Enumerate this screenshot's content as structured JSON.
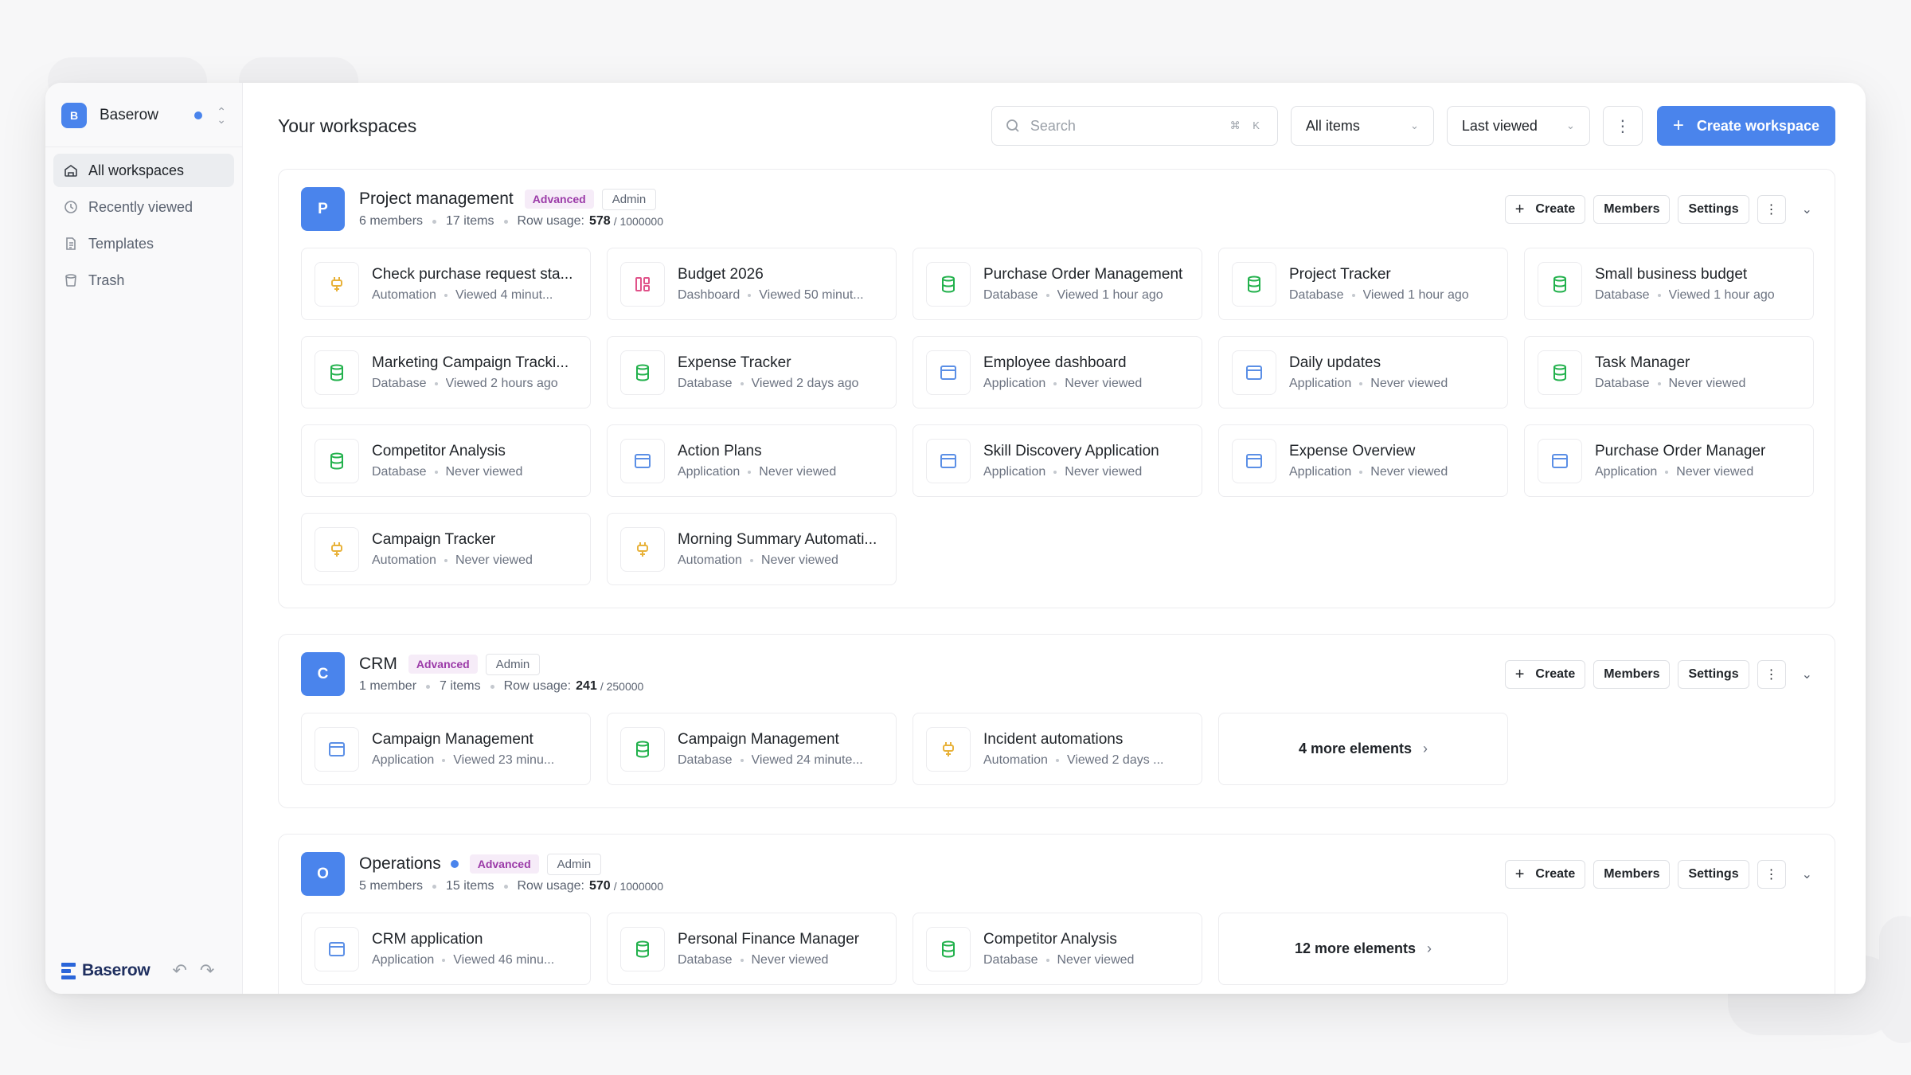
{
  "sidebar": {
    "workspace_badge": "B",
    "workspace_name": "Baserow",
    "nav": [
      {
        "label": "All workspaces",
        "icon": "home-icon"
      },
      {
        "label": "Recently viewed",
        "icon": "clock-icon"
      },
      {
        "label": "Templates",
        "icon": "document-icon"
      },
      {
        "label": "Trash",
        "icon": "trash-icon"
      }
    ],
    "logo_text": "Baserow"
  },
  "header": {
    "title": "Your workspaces",
    "search_placeholder": "Search",
    "search_shortcut": "⌘ K",
    "filter_value": "All items",
    "sort_value": "Last viewed",
    "create_label": "Create workspace"
  },
  "actions": {
    "create": "Create",
    "members": "Members",
    "settings": "Settings"
  },
  "colors": {
    "accent": "#4a84ec",
    "database": "#22b14c",
    "automation": "#e8b23a",
    "dashboard": "#e0538a",
    "application": "#5b8fe6"
  },
  "workspaces": [
    {
      "badge": "P",
      "name": "Project management",
      "plan": "Advanced",
      "role": "Admin",
      "members": "6 members",
      "items": "17 items",
      "row_usage_label": "Row usage:",
      "row_usage": "578",
      "row_limit": "/ 1000000",
      "tiles": [
        {
          "name": "Check purchase request sta...",
          "type": "Automation",
          "viewed": "Viewed 4 minut..."
        },
        {
          "name": "Budget 2026",
          "type": "Dashboard",
          "viewed": "Viewed 50 minut..."
        },
        {
          "name": "Purchase Order Management",
          "type": "Database",
          "viewed": "Viewed 1 hour ago"
        },
        {
          "name": "Project Tracker",
          "type": "Database",
          "viewed": "Viewed 1 hour ago"
        },
        {
          "name": "Small business budget",
          "type": "Database",
          "viewed": "Viewed 1 hour ago"
        },
        {
          "name": "Marketing Campaign Tracki...",
          "type": "Database",
          "viewed": "Viewed 2 hours ago"
        },
        {
          "name": "Expense Tracker",
          "type": "Database",
          "viewed": "Viewed 2 days ago"
        },
        {
          "name": "Employee dashboard",
          "type": "Application",
          "viewed": "Never viewed"
        },
        {
          "name": "Daily updates",
          "type": "Application",
          "viewed": "Never viewed"
        },
        {
          "name": "Task Manager",
          "type": "Database",
          "viewed": "Never viewed"
        },
        {
          "name": "Competitor Analysis",
          "type": "Database",
          "viewed": "Never viewed"
        },
        {
          "name": "Action Plans",
          "type": "Application",
          "viewed": "Never viewed"
        },
        {
          "name": "Skill Discovery Application",
          "type": "Application",
          "viewed": "Never viewed"
        },
        {
          "name": "Expense Overview",
          "type": "Application",
          "viewed": "Never viewed"
        },
        {
          "name": "Purchase Order Manager",
          "type": "Application",
          "viewed": "Never viewed"
        },
        {
          "name": "Campaign Tracker",
          "type": "Automation",
          "viewed": "Never viewed"
        },
        {
          "name": "Morning Summary Automati...",
          "type": "Automation",
          "viewed": "Never viewed"
        }
      ]
    },
    {
      "badge": "C",
      "name": "CRM",
      "plan": "Advanced",
      "role": "Admin",
      "members": "1 member",
      "items": "7 items",
      "row_usage_label": "Row usage:",
      "row_usage": "241",
      "row_limit": "/ 250000",
      "tiles": [
        {
          "name": "Campaign Management",
          "type": "Application",
          "viewed": "Viewed 23 minu..."
        },
        {
          "name": "Campaign Management",
          "type": "Database",
          "viewed": "Viewed 24 minute..."
        },
        {
          "name": "Incident automations",
          "type": "Automation",
          "viewed": "Viewed 2 days ..."
        }
      ],
      "more": "4 more elements"
    },
    {
      "badge": "O",
      "name": "Operations",
      "plan": "Advanced",
      "role": "Admin",
      "members": "5 members",
      "items": "15 items",
      "row_usage_label": "Row usage:",
      "row_usage": "570",
      "row_limit": "/ 1000000",
      "tiles": [
        {
          "name": "CRM application",
          "type": "Application",
          "viewed": "Viewed 46 minu..."
        },
        {
          "name": "Personal Finance Manager",
          "type": "Database",
          "viewed": "Never viewed"
        },
        {
          "name": "Competitor Analysis",
          "type": "Database",
          "viewed": "Never viewed"
        }
      ],
      "more": "12 more elements"
    }
  ]
}
